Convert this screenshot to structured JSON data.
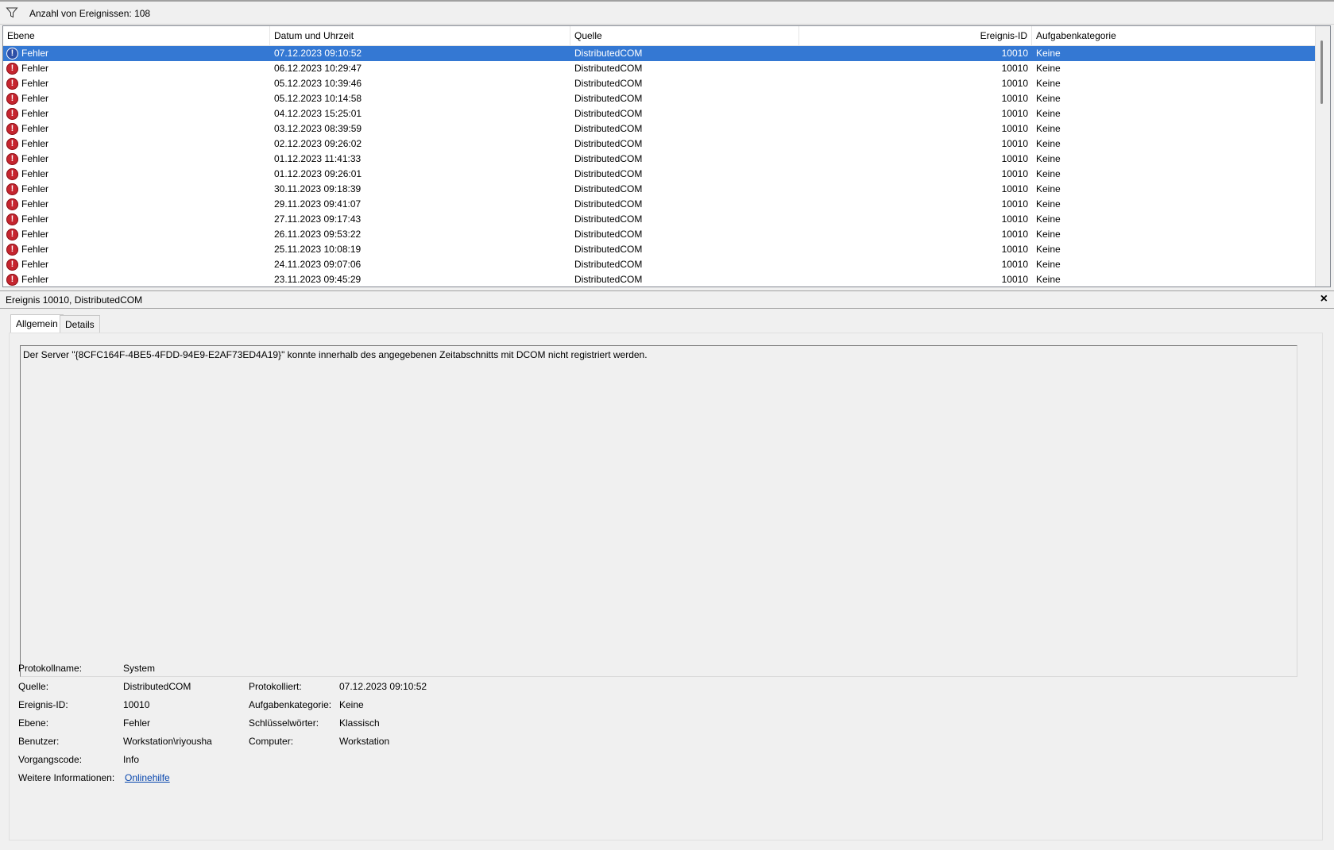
{
  "filterbar": {
    "label": "Anzahl von Ereignissen: 108"
  },
  "table": {
    "columns": [
      "Ebene",
      "Datum und Uhrzeit",
      "Quelle",
      "Ereignis-ID",
      "Aufgabenkategorie"
    ],
    "rows": [
      {
        "level": "Fehler",
        "datetime": "07.12.2023 09:10:52",
        "source": "DistributedCOM",
        "id": "10010",
        "category": "Keine",
        "selected": true
      },
      {
        "level": "Fehler",
        "datetime": "06.12.2023 10:29:47",
        "source": "DistributedCOM",
        "id": "10010",
        "category": "Keine"
      },
      {
        "level": "Fehler",
        "datetime": "05.12.2023 10:39:46",
        "source": "DistributedCOM",
        "id": "10010",
        "category": "Keine"
      },
      {
        "level": "Fehler",
        "datetime": "05.12.2023 10:14:58",
        "source": "DistributedCOM",
        "id": "10010",
        "category": "Keine"
      },
      {
        "level": "Fehler",
        "datetime": "04.12.2023 15:25:01",
        "source": "DistributedCOM",
        "id": "10010",
        "category": "Keine"
      },
      {
        "level": "Fehler",
        "datetime": "03.12.2023 08:39:59",
        "source": "DistributedCOM",
        "id": "10010",
        "category": "Keine"
      },
      {
        "level": "Fehler",
        "datetime": "02.12.2023 09:26:02",
        "source": "DistributedCOM",
        "id": "10010",
        "category": "Keine"
      },
      {
        "level": "Fehler",
        "datetime": "01.12.2023 11:41:33",
        "source": "DistributedCOM",
        "id": "10010",
        "category": "Keine"
      },
      {
        "level": "Fehler",
        "datetime": "01.12.2023 09:26:01",
        "source": "DistributedCOM",
        "id": "10010",
        "category": "Keine"
      },
      {
        "level": "Fehler",
        "datetime": "30.11.2023 09:18:39",
        "source": "DistributedCOM",
        "id": "10010",
        "category": "Keine"
      },
      {
        "level": "Fehler",
        "datetime": "29.11.2023 09:41:07",
        "source": "DistributedCOM",
        "id": "10010",
        "category": "Keine"
      },
      {
        "level": "Fehler",
        "datetime": "27.11.2023 09:17:43",
        "source": "DistributedCOM",
        "id": "10010",
        "category": "Keine"
      },
      {
        "level": "Fehler",
        "datetime": "26.11.2023 09:53:22",
        "source": "DistributedCOM",
        "id": "10010",
        "category": "Keine"
      },
      {
        "level": "Fehler",
        "datetime": "25.11.2023 10:08:19",
        "source": "DistributedCOM",
        "id": "10010",
        "category": "Keine"
      },
      {
        "level": "Fehler",
        "datetime": "24.11.2023 09:07:06",
        "source": "DistributedCOM",
        "id": "10010",
        "category": "Keine"
      },
      {
        "level": "Fehler",
        "datetime": "23.11.2023 09:45:29",
        "source": "DistributedCOM",
        "id": "10010",
        "category": "Keine"
      }
    ]
  },
  "detail": {
    "title": "Ereignis 10010, DistributedCOM",
    "close": "×",
    "tabs": [
      "Allgemein",
      "Details"
    ],
    "description": "Der Server \"{8CFC164F-4BE5-4FDD-94E9-E2AF73ED4A19}\" konnte innerhalb des angegebenen Zeitabschnitts mit DCOM nicht registriert werden.",
    "props": {
      "protokollname_label": "Protokollname:",
      "protokollname": "System",
      "quelle_label": "Quelle:",
      "quelle": "DistributedCOM",
      "protokolliert_label": "Protokolliert:",
      "protokolliert": "07.12.2023 09:10:52",
      "ereignisid_label": "Ereignis-ID:",
      "ereignisid": "10010",
      "aufgabenkategorie_label": "Aufgabenkategorie:",
      "aufgabenkategorie": "Keine",
      "ebene_label": "Ebene:",
      "ebene": "Fehler",
      "schluesselwoerter_label": "Schlüsselwörter:",
      "schluesselwoerter": "Klassisch",
      "benutzer_label": "Benutzer:",
      "benutzer": "Workstation\\riyousha",
      "computer_label": "Computer:",
      "computer": "Workstation",
      "vorgangscode_label": "Vorgangscode:",
      "vorgangscode": "Info",
      "weitere_label": "Weitere Informationen:",
      "weitere_link": "Onlinehilfe"
    }
  },
  "colors": {
    "selection": "#3478d3",
    "error": "#c5252f",
    "link": "#0645ad"
  },
  "icons": {
    "filter": "filter-icon",
    "error": "error-icon",
    "close": "close-icon"
  }
}
